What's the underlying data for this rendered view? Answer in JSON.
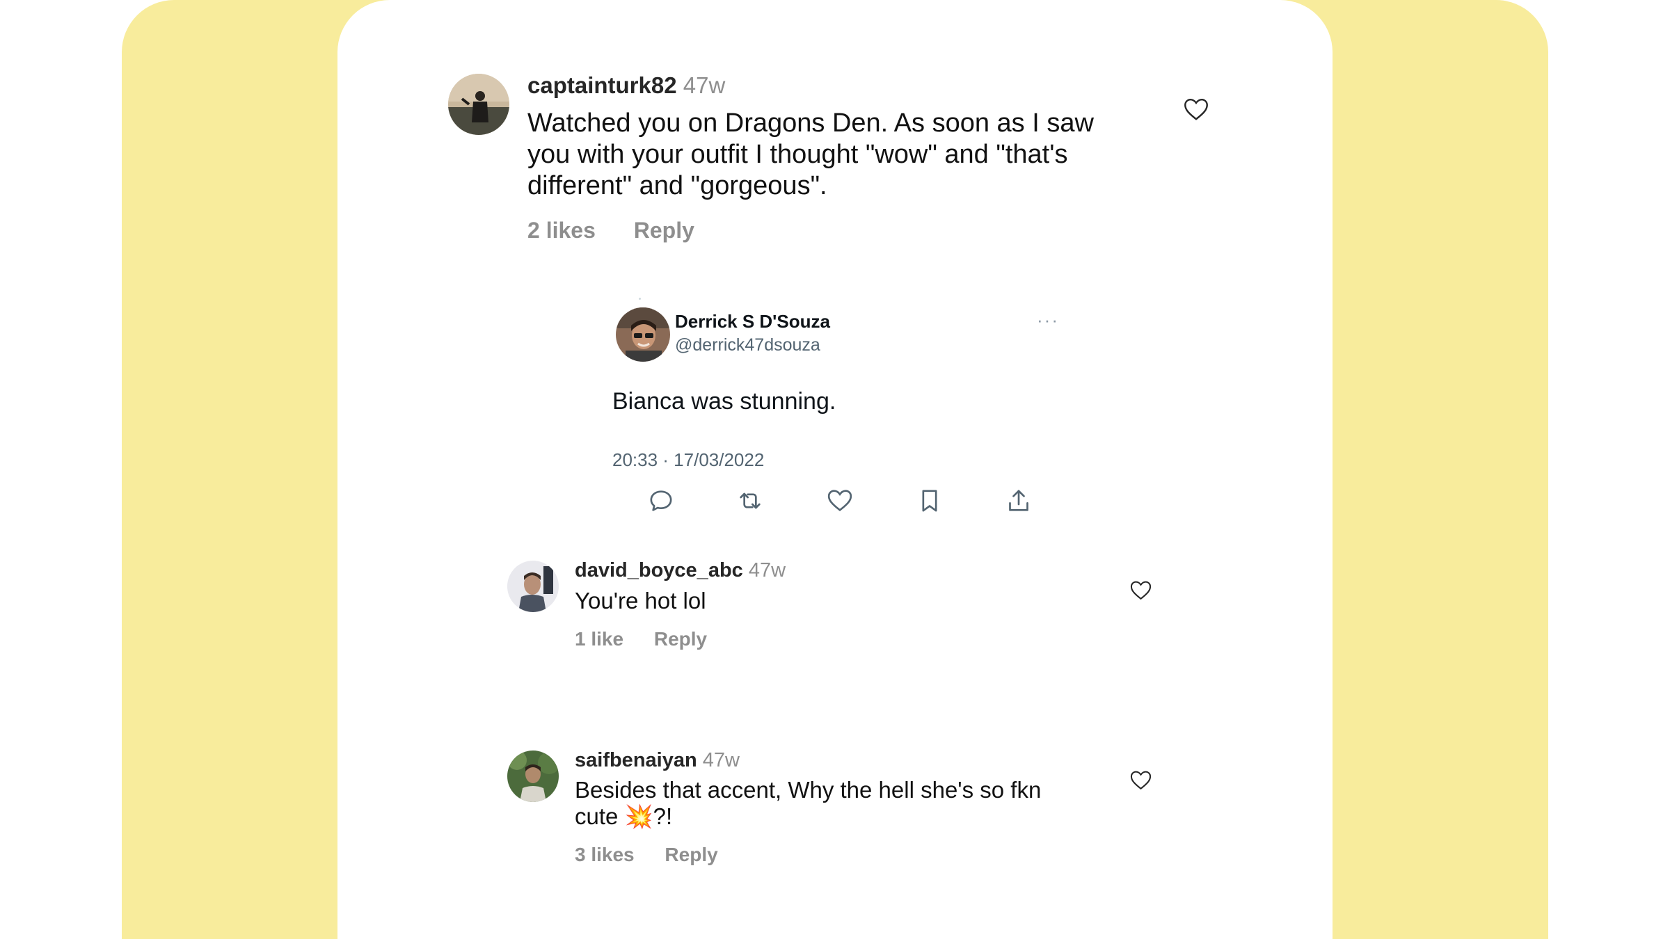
{
  "comments": [
    {
      "username": "captainturk82",
      "time": "47w",
      "text": "Watched you on Dragons Den. As soon as I saw you with your outfit I thought \"wow\" and \"that's different\" and \"gorgeous\".",
      "likes": "2 likes",
      "reply": "Reply"
    },
    {
      "username": "david_boyce_abc",
      "time": "47w",
      "text": "You're hot lol",
      "likes": "1 like",
      "reply": "Reply"
    },
    {
      "username": "saifbenaiyan",
      "time": "47w",
      "text": "Besides that accent, Why the hell she's so fkn cute 💥?!",
      "likes": "3 likes",
      "reply": "Reply"
    }
  ],
  "tweet": {
    "name": "Derrick S D'Souza",
    "handle": "@derrick47dsouza",
    "more": "···",
    "text": "Bianca was stunning.",
    "date": "20:33 · 17/03/2022",
    "actions": [
      "reply-icon",
      "retweet-icon",
      "like-icon",
      "bookmark-icon",
      "share-icon"
    ]
  },
  "colors": {
    "background": "#f8ec9c",
    "card": "#ffffff",
    "muted": "#8e8e8e"
  }
}
